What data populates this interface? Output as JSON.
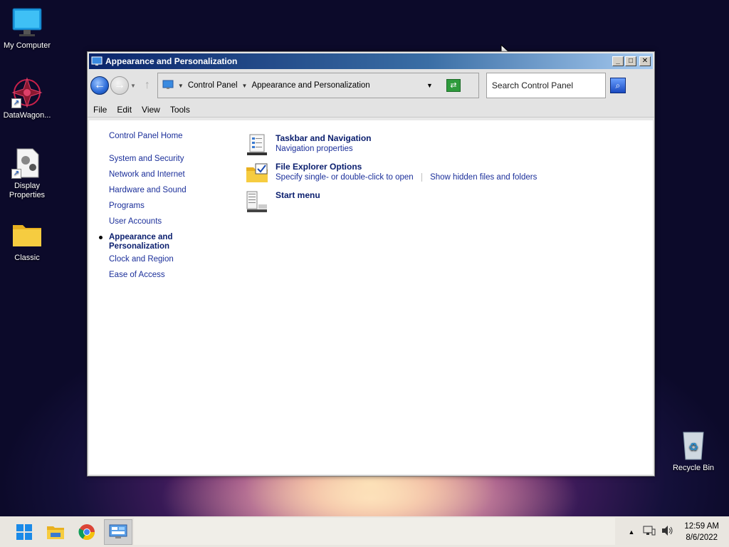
{
  "desktop": {
    "icons": [
      {
        "label": "My Computer"
      },
      {
        "label": "DataWagon..."
      },
      {
        "label": "Display\nProperties"
      },
      {
        "label": "Classic"
      },
      {
        "label": "Recycle Bin"
      }
    ]
  },
  "window": {
    "title": "Appearance and Personalization",
    "address": {
      "crumb1": "Control Panel",
      "crumb2": "Appearance and Personalization"
    },
    "search": {
      "placeholder": "Search Control Panel"
    },
    "menu": [
      "File",
      "Edit",
      "View",
      "Tools"
    ],
    "sidebar": {
      "home": "Control Panel Home",
      "items": [
        "System and Security",
        "Network and Internet",
        "Hardware and Sound",
        "Programs",
        "User Accounts"
      ],
      "active_line1": "Appearance and",
      "active_line2": "Personalization",
      "items_after": [
        "Clock and Region",
        "Ease of Access"
      ]
    },
    "categories": [
      {
        "title": "Taskbar and Navigation",
        "links": [
          "Navigation properties"
        ]
      },
      {
        "title": "File Explorer Options",
        "links": [
          "Specify single- or double-click to open",
          "Show hidden files and folders"
        ]
      },
      {
        "title": "Start menu",
        "links": []
      }
    ]
  },
  "taskbar": {
    "time": "12:59 AM",
    "date": "8/6/2022"
  },
  "colors": {
    "link": "#1b2f9a",
    "title_link": "#0a1e6e",
    "titlebar_start": "#0a246a"
  }
}
